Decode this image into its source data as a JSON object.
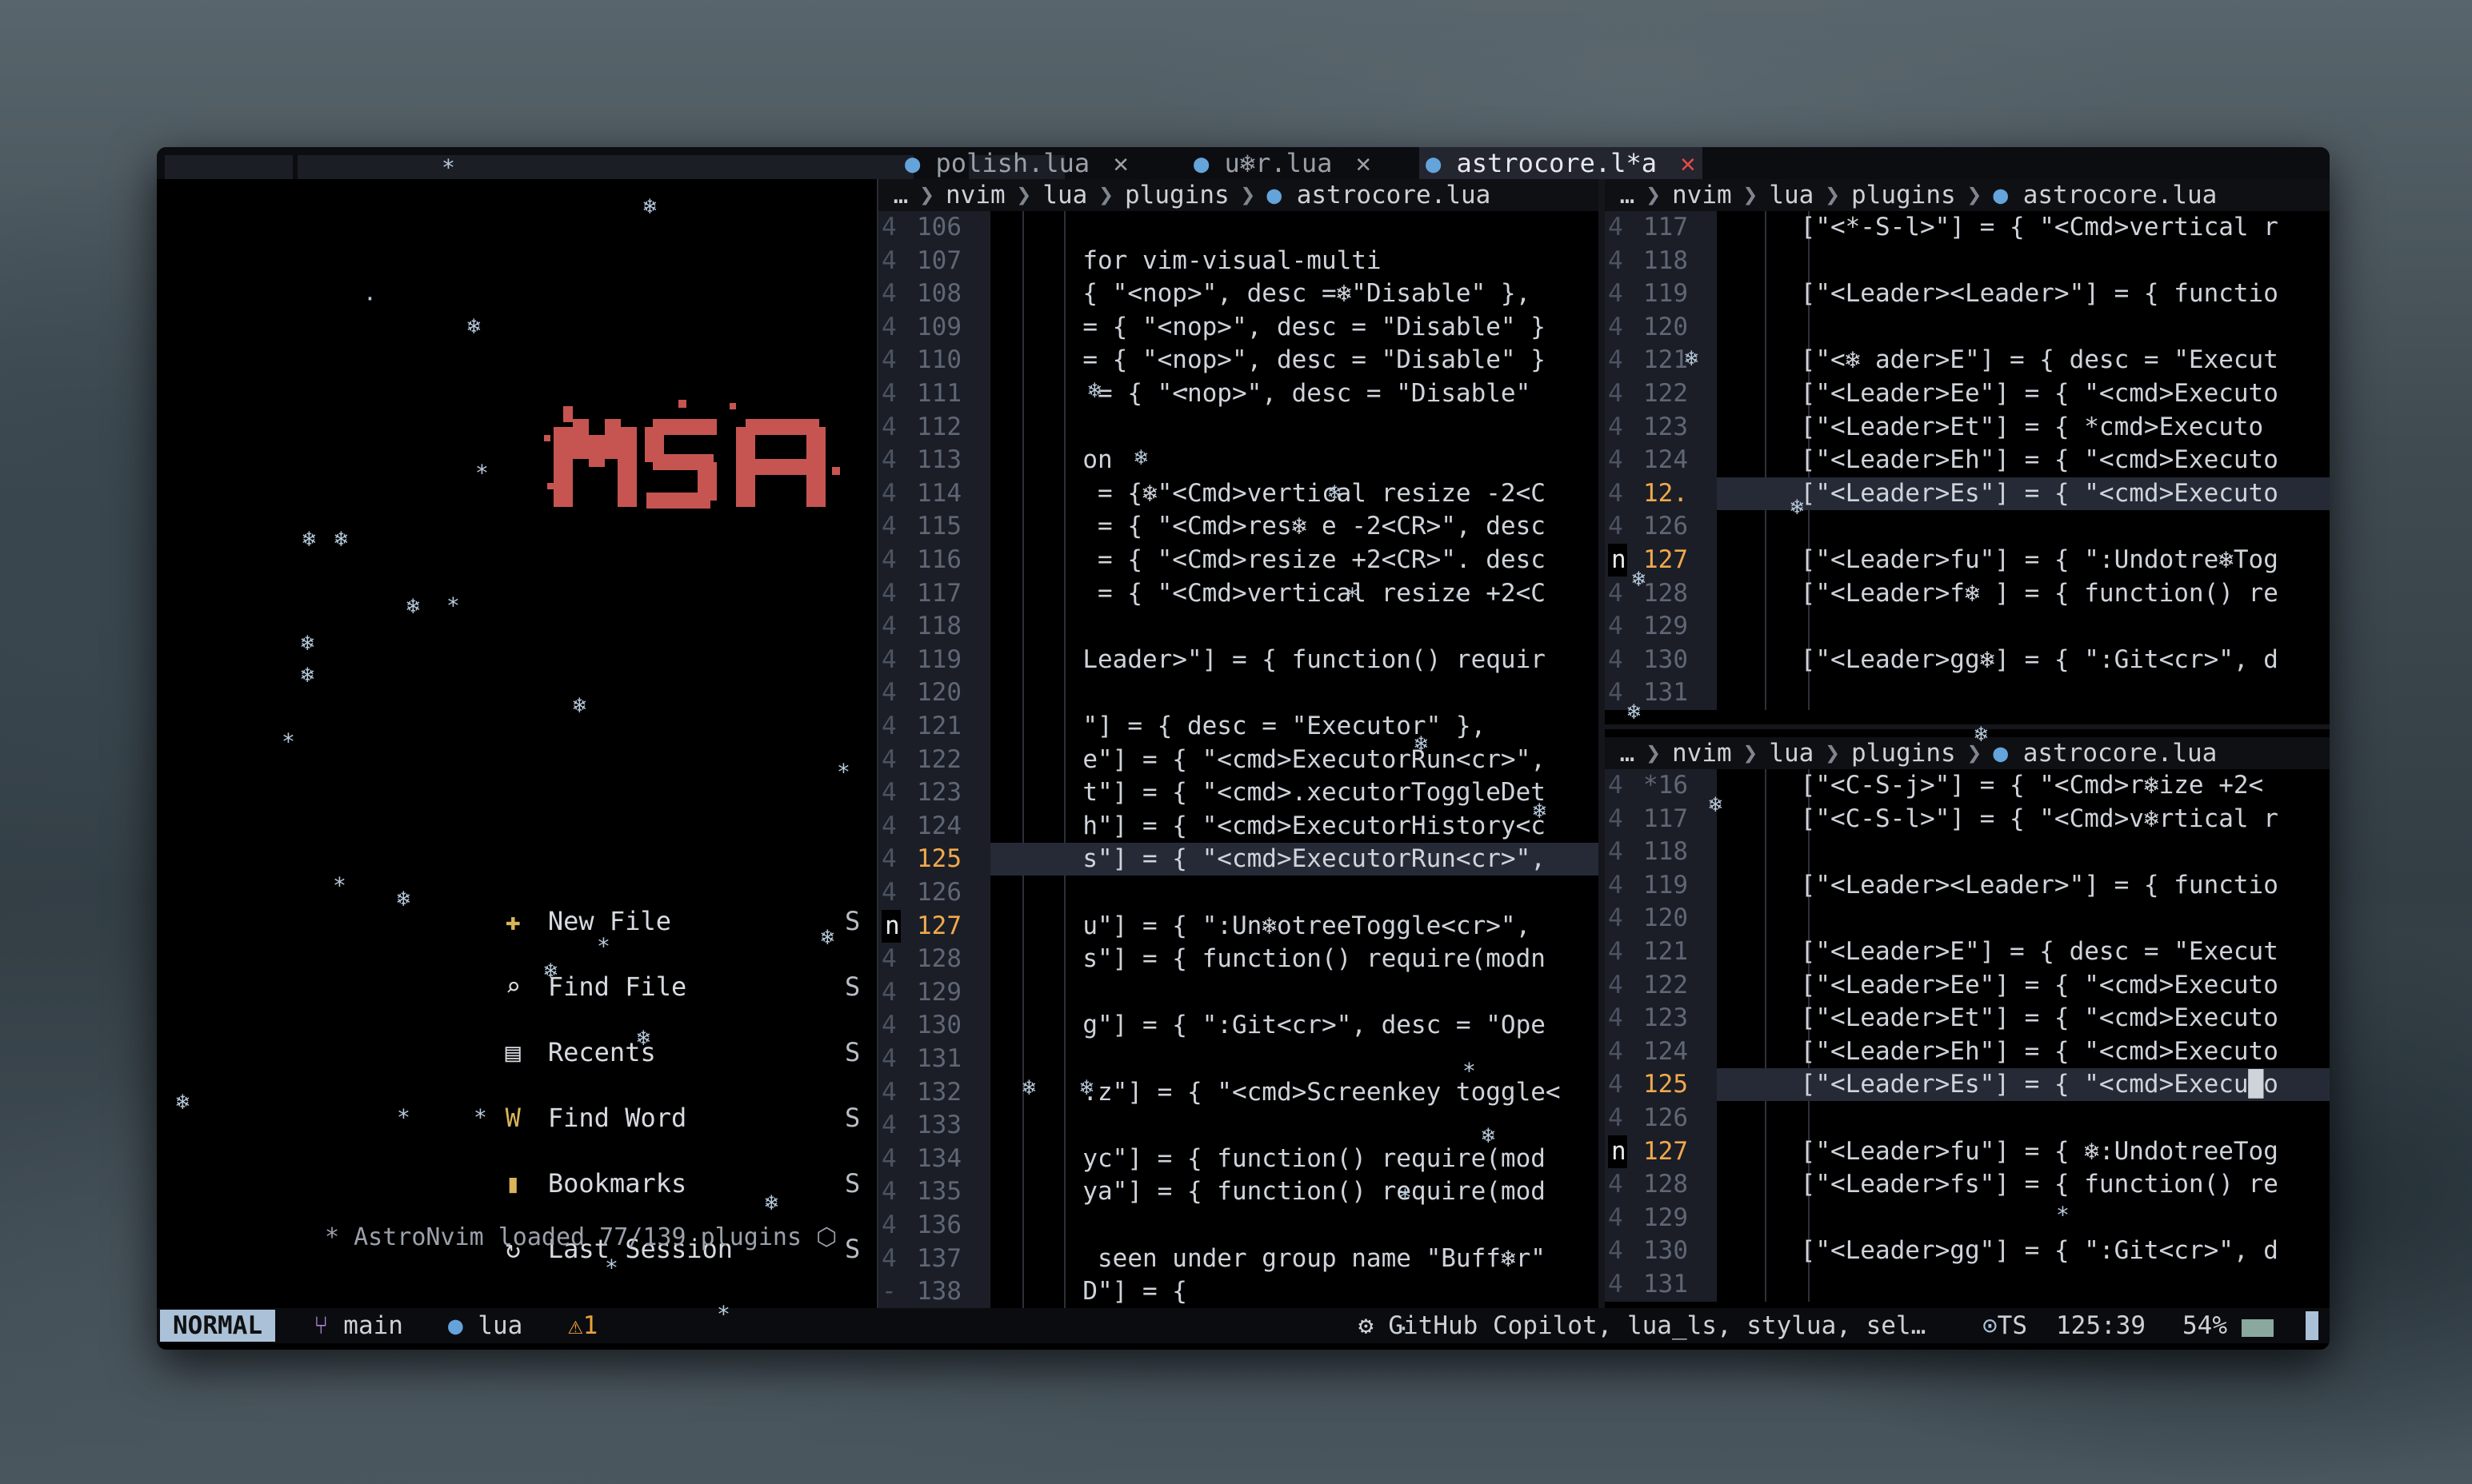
{
  "tabline": {
    "tabs": [
      {
        "icon": "lua-icon",
        "label": "polish.lua",
        "close": "✕",
        "active": false
      },
      {
        "icon": "lua-icon",
        "label": "u❄r.lua",
        "close": "✕",
        "active": false
      },
      {
        "icon": "lua-icon",
        "label": "astrocore.l*a",
        "close": "✕",
        "active": true
      }
    ]
  },
  "dashboard": {
    "logo_text": "MSA",
    "menu": [
      {
        "icon": "plus-icon",
        "glyph": "✚",
        "label": "New File",
        "key": "S"
      },
      {
        "icon": "search-icon",
        "glyph": "⌕",
        "label": "Find File",
        "key": "S"
      },
      {
        "icon": "document-icon",
        "glyph": "▤",
        "label": "Recents",
        "key": "S"
      },
      {
        "icon": "word-icon",
        "glyph": "W",
        "label": "Find Word",
        "key": "S"
      },
      {
        "icon": "bookmark-icon",
        "glyph": "▮",
        "label": "Bookmarks",
        "key": "S"
      },
      {
        "icon": "refresh-icon",
        "glyph": "↻",
        "label": "Last Session",
        "key": "S"
      }
    ],
    "loaded": "* AstroNvim loaded 77/139 plugins"
  },
  "winbar": {
    "left": [
      "…",
      "nvim",
      "lua",
      "plugins",
      "astrocore.lua"
    ],
    "right_top": [
      "…",
      "nvim",
      "lua",
      "plugins",
      "astrocore.lua"
    ],
    "right_bottom": [
      "…",
      "nvim",
      "lua",
      "plugins",
      "astrocore.lua"
    ]
  },
  "left_editor": {
    "lines": [
      {
        "sign": "4",
        "num": "106",
        "code": ""
      },
      {
        "sign": "4",
        "num": "107",
        "code": "  for vim-visual-multi"
      },
      {
        "sign": "4",
        "num": "108",
        "code": "  { \"<nop>\", desc =❄\"Disable\" },"
      },
      {
        "sign": "4",
        "num": "109",
        "code": "  = { \"<nop>\", desc = \"Disable\" }"
      },
      {
        "sign": "4",
        "num": "110",
        "code": "  = { \"<nop>\", desc = \"Disable\" }"
      },
      {
        "sign": "4",
        "num": "111",
        "code": "   = { \"<nop>\", desc = \"Disable\""
      },
      {
        "sign": "4",
        "num": "112",
        "code": ""
      },
      {
        "sign": "4",
        "num": "113",
        "code": "  on"
      },
      {
        "sign": "4",
        "num": "114",
        "code": "   = {❄\"<Cmd>vertical resize -2<C"
      },
      {
        "sign": "4",
        "num": "115",
        "code": "   = { \"<Cmd>res❄ e -2<CR>\", desc"
      },
      {
        "sign": "4",
        "num": "116",
        "code": "   = { \"<Cmd>resize +2<CR>\". desc"
      },
      {
        "sign": "4",
        "num": "117",
        "code": "   = { \"<Cmd>vertical resize +2<C"
      },
      {
        "sign": "4",
        "num": "118",
        "code": ""
      },
      {
        "sign": "4",
        "num": "119",
        "code": "  Leader>\"] = { function() requir"
      },
      {
        "sign": "4",
        "num": "120",
        "code": ""
      },
      {
        "sign": "4",
        "num": "121",
        "code": "  \"] = { desc = \"Executor\" },"
      },
      {
        "sign": "4",
        "num": "122",
        "code": "  e\"] = { \"<cmd>ExecutorRun<cr>\","
      },
      {
        "sign": "4",
        "num": "123",
        "code": "  t\"] = { \"<cmd>.xecutorToggleDet"
      },
      {
        "sign": "4",
        "num": "124",
        "code": "  h\"] = { \"<cmd>ExecutorHistory<c"
      },
      {
        "sign": "4",
        "num": "125",
        "code": "  s\"] = { \"<cmd>ExecutorRun<cr>\","
      },
      {
        "sign": "4",
        "num": "126",
        "code": ""
      },
      {
        "sign": "n",
        "num": "127",
        "code": "  u\"] = { \":Un❄otreeToggle<cr>\","
      },
      {
        "sign": "4",
        "num": "128",
        "code": "  s\"] = { function() require(modn"
      },
      {
        "sign": "4",
        "num": "129",
        "code": ""
      },
      {
        "sign": "4",
        "num": "130",
        "code": "  g\"] = { \":Git<cr>\", desc = \"Ope"
      },
      {
        "sign": "4",
        "num": "131",
        "code": ""
      },
      {
        "sign": "4",
        "num": "132",
        "code": "  .z\"] = { \"<cmd>Screenkey toggle<"
      },
      {
        "sign": "4",
        "num": "133",
        "code": ""
      },
      {
        "sign": "4",
        "num": "134",
        "code": "  yc\"] = { function() require(mod"
      },
      {
        "sign": "4",
        "num": "135",
        "code": "  ya\"] = { function() require(mod"
      },
      {
        "sign": "4",
        "num": "136",
        "code": ""
      },
      {
        "sign": "4",
        "num": "137",
        "code": "   seen under group name \"Buff❄r\""
      },
      {
        "sign": "-",
        "num": "138",
        "code": "  D\"] = {"
      }
    ]
  },
  "right_top_editor": {
    "lines": [
      {
        "sign": "4",
        "num": "117",
        "code": "    [\"<*-S-l>\"] = { \"<Cmd>vertical r"
      },
      {
        "sign": "4",
        "num": "118",
        "code": ""
      },
      {
        "sign": "4",
        "num": "119",
        "code": "    [\"<Leader><Leader>\"] = { functio"
      },
      {
        "sign": "4",
        "num": "120",
        "code": ""
      },
      {
        "sign": "4",
        "num": "121",
        "code": "    [\"<❄ ader>E\"] = { desc = \"Execut"
      },
      {
        "sign": "4",
        "num": "122",
        "code": "    [\"<Leader>Ee\"] = { \"<cmd>Executo"
      },
      {
        "sign": "4",
        "num": "123",
        "code": "    [\"<Leader>Et\"] = { *cmd>Executo"
      },
      {
        "sign": "4",
        "num": "124",
        "code": "    [\"<Leader>Eh\"] = { \"<cmd>Executo"
      },
      {
        "sign": "4",
        "num": "12.",
        "code": "    [\"<Leader>Es\"] = { \"<cmd>Executo"
      },
      {
        "sign": "4",
        "num": "126",
        "code": ""
      },
      {
        "sign": "n",
        "num": "127",
        "code": "    [\"<Leader>fu\"] = { \":Undotre❄Tog"
      },
      {
        "sign": "4",
        "num": "128",
        "code": "    [\"<Leader>f❄ ] = { function() re"
      },
      {
        "sign": "4",
        "num": "129",
        "code": ""
      },
      {
        "sign": "4",
        "num": "130",
        "code": "    [\"<Leader>gg❄] = { \":Git<cr>\", d"
      },
      {
        "sign": "4",
        "num": "131",
        "code": ""
      }
    ]
  },
  "right_bottom_editor": {
    "lines": [
      {
        "sign": "4",
        "num": "*16",
        "code": "    [\"<C-S-j>\"] = { \"<Cmd>r❄ize +2<"
      },
      {
        "sign": "4",
        "num": "117",
        "code": "    [\"<C-S-l>\"] = { \"<Cmd>v❄rtical r"
      },
      {
        "sign": "4",
        "num": "118",
        "code": ""
      },
      {
        "sign": "4",
        "num": "119",
        "code": "    [\"<Leader><Leader>\"] = { functio"
      },
      {
        "sign": "4",
        "num": "120",
        "code": ""
      },
      {
        "sign": "4",
        "num": "121",
        "code": "    [\"<Leader>E\"] = { desc = \"Execut"
      },
      {
        "sign": "4",
        "num": "122",
        "code": "    [\"<Leader>Ee\"] = { \"<cmd>Executo"
      },
      {
        "sign": "4",
        "num": "123",
        "code": "    [\"<Leader>Et\"] = { \"<cmd>Executo"
      },
      {
        "sign": "4",
        "num": "124",
        "code": "    [\"<Leader>Eh\"] = { \"<cmd>Executo"
      },
      {
        "sign": "4",
        "num": "125",
        "code": "    [\"<Leader>Es\"] = { \"<cmd>Execu█o"
      },
      {
        "sign": "4",
        "num": "126",
        "code": ""
      },
      {
        "sign": "n",
        "num": "127",
        "code": "    [\"<Leader>fu\"] = { ❄:UndotreeTog"
      },
      {
        "sign": "4",
        "num": "128",
        "code": "    [\"<Leader>fs\"] = { function() re"
      },
      {
        "sign": "4",
        "num": "129",
        "code": ""
      },
      {
        "sign": "4",
        "num": "130",
        "code": "    [\"<Leader>gg\"] = { \":Git<cr>\", d"
      },
      {
        "sign": "4",
        "num": "131",
        "code": ""
      }
    ]
  },
  "statusline": {
    "mode": "NORMAL",
    "branch": "main",
    "filetype": "lua",
    "diagnostics": "1",
    "lsp": "GitHub Copilot, lua_ls, stylua, sel…",
    "treesitter": "TS",
    "position": "125:39",
    "percent": "54%"
  },
  "colors": {
    "accent": "#aac1d8",
    "number_current": "#f0a94d",
    "logo": "#c65551",
    "icon": "#d9b45a",
    "warning": "#e8a13a"
  }
}
